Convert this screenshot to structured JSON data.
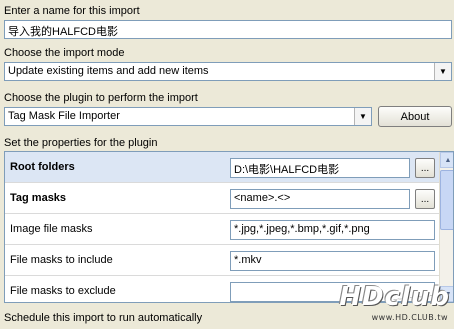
{
  "name_section": {
    "label": "Enter a name for this import",
    "value": "导入我的HALFCD电影"
  },
  "mode_section": {
    "label": "Choose the import mode",
    "selected": "Update existing items and add new items"
  },
  "plugin_section": {
    "label": "Choose the plugin to perform the import",
    "selected": "Tag Mask File Importer",
    "about_label": "About"
  },
  "properties": {
    "label": "Set the properties for the plugin",
    "rows": [
      {
        "name": "Root folders",
        "value": "D:\\电影\\HALFCD电影",
        "bold": true,
        "browse": "..."
      },
      {
        "name": "Tag masks",
        "value": "<name>.<>",
        "bold": true,
        "browse": "..."
      },
      {
        "name": "Image file masks",
        "value": "*.jpg,*.jpeg,*.bmp,*.gif,*.png",
        "bold": false
      },
      {
        "name": "File masks to include",
        "value": "*.mkv",
        "bold": false
      },
      {
        "name": "File masks to exclude",
        "value": "",
        "bold": false
      }
    ]
  },
  "schedule": {
    "label": "Schedule this import to run automatically"
  },
  "watermark": {
    "brand": "HDclub",
    "url": "www.HD.CLUB.tw"
  },
  "icons": {
    "dropdown": "chevron-down-icon",
    "scroll_up": "arrow-up-icon",
    "scroll_down": "arrow-down-icon"
  }
}
